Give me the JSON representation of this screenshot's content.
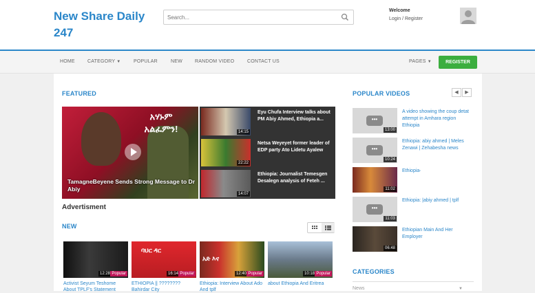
{
  "header": {
    "logo": "New Share Daily 247",
    "search_placeholder": "Search...",
    "welcome": "Welcome",
    "login": "Login / Register"
  },
  "nav": {
    "items": [
      "HOME",
      "CATEGORY",
      "POPULAR",
      "NEW",
      "RANDOM VIDEO",
      "CONTACT US"
    ],
    "pages": "PAGES",
    "register": "REGISTER"
  },
  "featured": {
    "title": "FEATURED",
    "main_image_text": "አሃኑም አልፈምን!",
    "main_caption": "TamagneBeyene Sends Strong Message to Dr Abiy",
    "list": [
      {
        "title": "Eyu Chufa Interview talks about PM Abiy Ahmed, Ethiopia a...",
        "time": "14:15"
      },
      {
        "title": "Netsa Weyeyet former leader of EDP party Ato Lidetu Ayalew",
        "time": "22:22"
      },
      {
        "title": "Ethiopia: Journalist Temesgen Desalegn analysis of Feteh ...",
        "time": "14:07"
      }
    ]
  },
  "advertisement": "Advertisment",
  "new_section": {
    "title": "NEW",
    "videos": [
      {
        "title": "Activist Seyum Teshome About TPLF's Statement",
        "time": "12:28",
        "badge": "Popular"
      },
      {
        "title": "ETHIOPIA || ???????? Bahirdar City",
        "time": "16:14",
        "badge": "Popular",
        "thumb_text": "ባህር ዳር"
      },
      {
        "title": "Ethiopia: Interview About Ado And tplf",
        "time": "12:40",
        "badge": "Popular",
        "thumb_text": "አድ እና"
      },
      {
        "title": "about Ethiopia And Eritrea",
        "time": "10:18",
        "badge": "Popular"
      }
    ]
  },
  "popular_videos": {
    "title": "POPULAR VIDEOS",
    "items": [
      {
        "title": "A video showing the coup detat attempt in Amhara region Ethiopia",
        "time": "13:00"
      },
      {
        "title": "Ethiopia: abiy ahmed | Meles Zenawi | Zehabesha news",
        "time": "10:24"
      },
      {
        "title": "Ethiopia፡",
        "time": "11:02"
      },
      {
        "title": "Ethiopia: |abiy ahmed | tplf",
        "time": "11:03"
      },
      {
        "title": "Ethiopian Main And Her Employer",
        "time": "06:48"
      }
    ]
  },
  "categories": {
    "title": "CATEGORIES",
    "selected": "News"
  },
  "colors": {
    "accent": "#2a86c9",
    "register": "#3cae3f",
    "badge": "#c2185b"
  }
}
